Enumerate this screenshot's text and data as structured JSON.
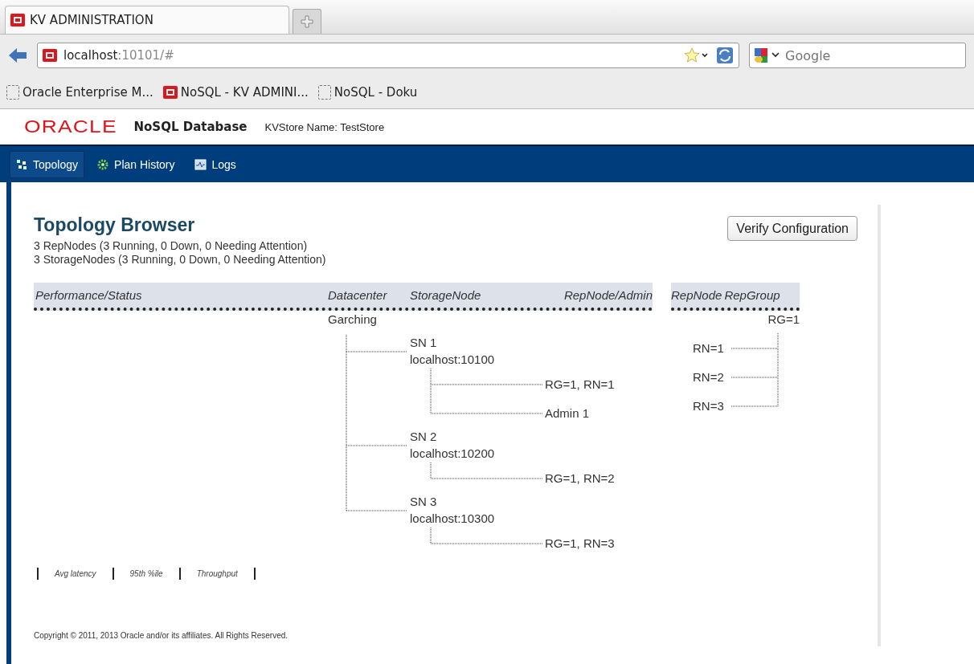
{
  "browser": {
    "tabs": [
      {
        "title": "KV ADMINISTRATION",
        "selected": true
      }
    ],
    "url": {
      "host": "localhost",
      "rest": ":10101/#"
    },
    "search": {
      "placeholder": "Google"
    },
    "bookmarks": [
      {
        "label": "Oracle Enterprise M...",
        "kind": "blank"
      },
      {
        "label": "NoSQL - KV ADMINI...",
        "kind": "oracle"
      },
      {
        "label": "NoSQL - Doku",
        "kind": "blank"
      }
    ]
  },
  "header": {
    "logo": "ORACLE",
    "product": "NoSQL Database",
    "store": "KVStore Name: TestStore"
  },
  "nav": [
    {
      "label": "Topology",
      "kind": "topology",
      "selected": true
    },
    {
      "label": "Plan History",
      "kind": "plans",
      "selected": false
    },
    {
      "label": "Logs",
      "kind": "logs",
      "selected": false
    }
  ],
  "page": {
    "title": "Topology Browser",
    "summary": [
      "3 RepNodes (3 Running, 0 Down, 0 Needing Attention)",
      "3 StorageNodes (3 Running, 0 Down, 0 Needing Attention)"
    ],
    "verify_button": "Verify Configuration",
    "columns": [
      "Performance/Status",
      "Datacenter",
      "StorageNode",
      "RepNode/Admin"
    ],
    "group_columns": [
      "RepNode",
      "RepGroup"
    ],
    "datacenters": [
      {
        "name": "Garching",
        "children": [
          {
            "name": "SN 1",
            "host": "localhost:10100",
            "children": [
              {
                "label": "RG=1, RN=1"
              },
              {
                "label": "Admin 1"
              }
            ]
          },
          {
            "name": "SN 2",
            "host": "localhost:10200",
            "children": [
              {
                "label": "RG=1, RN=2"
              }
            ]
          },
          {
            "name": "SN 3",
            "host": "localhost:10300",
            "children": [
              {
                "label": "RG=1, RN=3"
              }
            ]
          }
        ]
      }
    ],
    "repgroups": [
      {
        "name": "RG=1",
        "children": [
          {
            "label": "RN=1"
          },
          {
            "label": "RN=2"
          },
          {
            "label": "RN=3"
          }
        ]
      }
    ],
    "metrics": [
      "Avg latency",
      "95th %ile",
      "Throughput"
    ],
    "copyright": "Copyright © 2011, 2013 Oracle and/or its affiliates. All Rights Reserved."
  }
}
